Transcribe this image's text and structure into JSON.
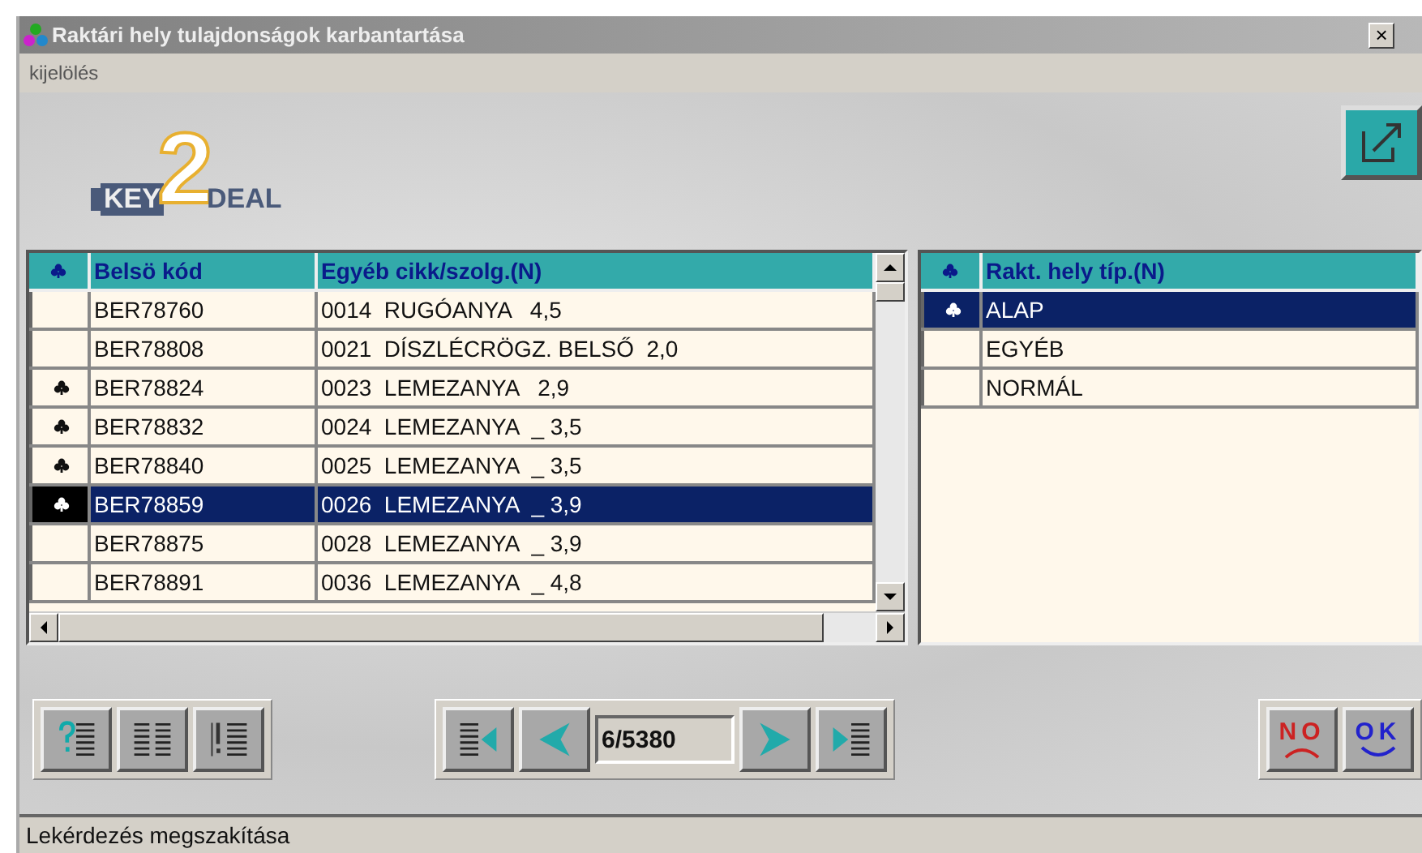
{
  "window": {
    "title": "Raktári hely tulajdonságok karbantartása",
    "close": "×"
  },
  "menu": [
    {
      "label": "kijelölés"
    }
  ],
  "logo": {
    "left": "KEY",
    "middle": "2",
    "right": "DEAL"
  },
  "items_table": {
    "columns": [
      "Belsö kód",
      "Egyéb cikk/szolg.(N)"
    ],
    "rows": [
      {
        "code": "BER78760",
        "item": "0014  RUGÓANYA   4,5",
        "marked": false,
        "selected": false
      },
      {
        "code": "BER78808",
        "item": "0021  DÍSZLÉCRÖGZ. BELSŐ  2,0",
        "marked": false,
        "selected": false
      },
      {
        "code": "BER78824",
        "item": "0023  LEMEZANYA   2,9",
        "marked": true,
        "selected": false
      },
      {
        "code": "BER78832",
        "item": "0024  LEMEZANYA  _ 3,5",
        "marked": true,
        "selected": false
      },
      {
        "code": "BER78840",
        "item": "0025  LEMEZANYA  _ 3,5",
        "marked": true,
        "selected": false
      },
      {
        "code": "BER78859",
        "item": "0026  LEMEZANYA  _ 3,9",
        "marked": true,
        "selected": true
      },
      {
        "code": "BER78875",
        "item": "0028  LEMEZANYA  _ 3,9",
        "marked": false,
        "selected": false
      },
      {
        "code": "BER78891",
        "item": "0036  LEMEZANYA  _ 4,8",
        "marked": false,
        "selected": false
      }
    ]
  },
  "type_table": {
    "columns": [
      "Rakt. hely típ.(N)"
    ],
    "rows": [
      {
        "type": "ALAP",
        "marked": true,
        "selected": true
      },
      {
        "type": "EGYÉB",
        "marked": false,
        "selected": false
      },
      {
        "type": "NORMÁL",
        "marked": false,
        "selected": false
      }
    ]
  },
  "navigator": {
    "position": "6/5380"
  },
  "actions": [
    {
      "kind": "no",
      "label": "NO"
    },
    {
      "kind": "ok",
      "label": "OK"
    }
  ],
  "status_bar": "Lekérdezés megszakítása"
}
